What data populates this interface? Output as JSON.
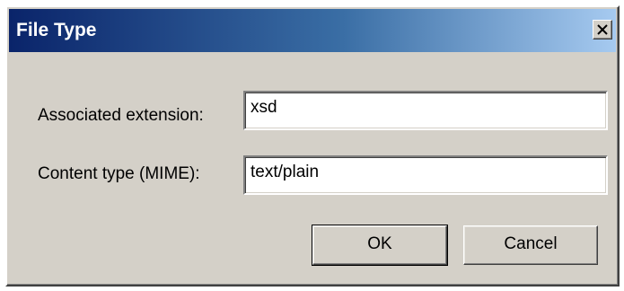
{
  "window": {
    "title": "File Type",
    "close_icon": "close-icon"
  },
  "form": {
    "extension_label": "Associated extension:",
    "extension_value": "xsd",
    "mime_label": "Content type (MIME):",
    "mime_value": "text/plain"
  },
  "buttons": {
    "ok_label": "OK",
    "cancel_label": "Cancel"
  },
  "colors": {
    "title_gradient_start": "#0a246a",
    "title_gradient_end": "#a6caf0",
    "dialog_bg": "#d4d0c8"
  }
}
